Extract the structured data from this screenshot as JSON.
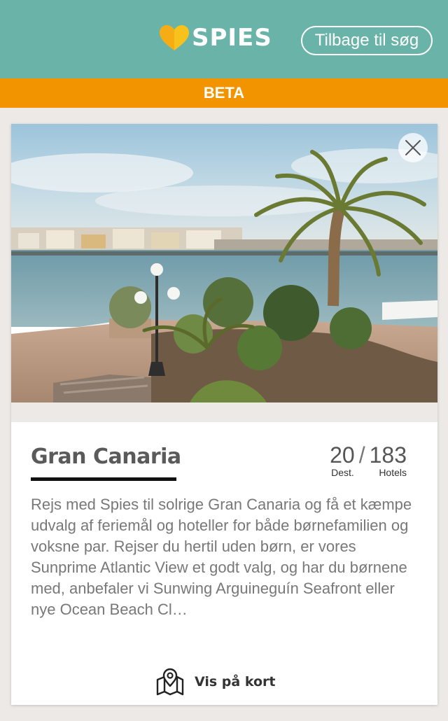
{
  "header": {
    "logo_text": "SPIES",
    "back_button_label": "Tilbage til søg",
    "brand_color": "#69b3a8"
  },
  "beta_banner": {
    "label": "BETA",
    "color": "#f29400"
  },
  "destination_card": {
    "title": "Gran Canaria",
    "stats": {
      "destinations": "20",
      "separator": "/",
      "hotels": "183",
      "destinations_label": "Dest.",
      "hotels_label": "Hotels"
    },
    "description": "Rejs med Spies til solrige Gran Canaria og få et kæmpe udvalg af feriemål og hoteller for både børnefamilien og voksne par. Rejser du hertil uden børn, er vores Sunprime Atlantic View et godt valg, og har du børnene med, anbefaler vi Sunwing Arguineguín Seafront eller nye Ocean Beach Cl…",
    "map_link_label": "Vis på kort",
    "icons": {
      "close": "close-icon",
      "map": "map-pin-icon"
    }
  }
}
